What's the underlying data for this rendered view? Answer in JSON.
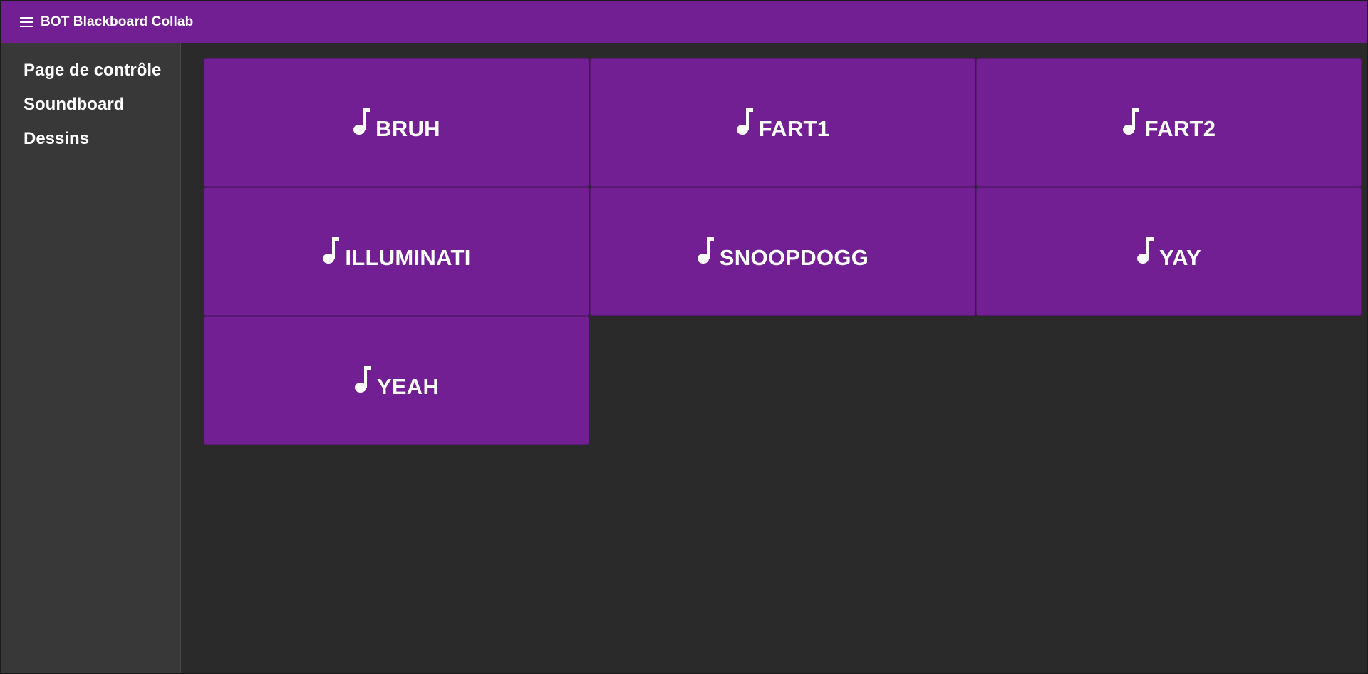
{
  "header": {
    "title": "BOT Blackboard Collab",
    "menu_icon": "hamburger-menu-icon",
    "background_color": "#721f94"
  },
  "sidebar": {
    "background_color": "#383838",
    "items": [
      {
        "label": "Page de contrôle"
      },
      {
        "label": "Soundboard"
      },
      {
        "label": "Dessins"
      }
    ]
  },
  "soundboard": {
    "button_icon": "music-note-icon",
    "button_color": "#721f94",
    "buttons": [
      {
        "label": "BRUH"
      },
      {
        "label": "FART1"
      },
      {
        "label": "FART2"
      },
      {
        "label": "ILLUMINATI"
      },
      {
        "label": "SNOOPDOGG"
      },
      {
        "label": "YAY"
      },
      {
        "label": "YEAH"
      }
    ]
  }
}
